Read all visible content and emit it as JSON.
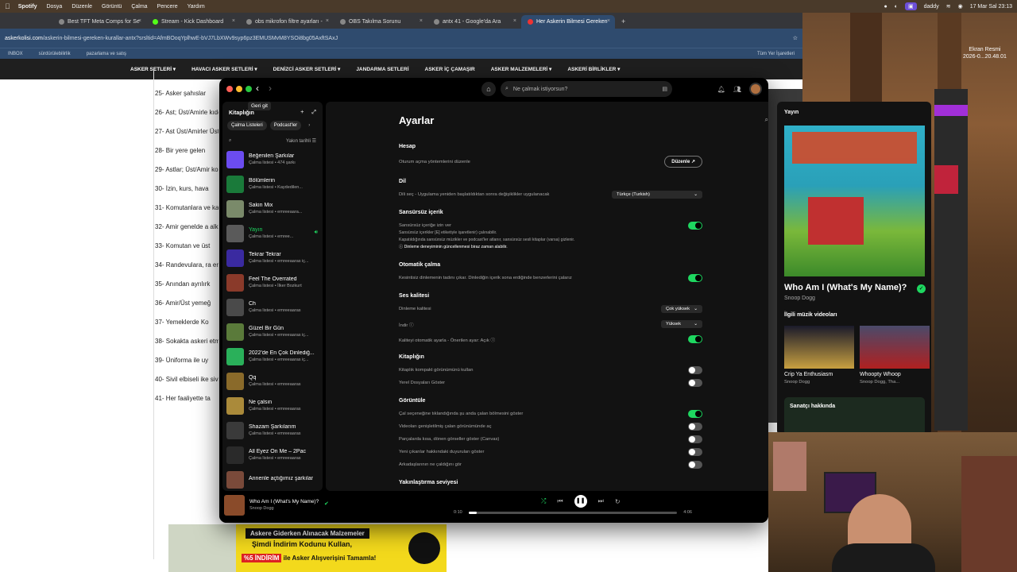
{
  "menubar": {
    "app": "Spotify",
    "items": [
      "Dosya",
      "Düzenle",
      "Görüntü",
      "Çalma",
      "Pencere",
      "Yardım"
    ],
    "user": "daddy",
    "clock": "17 Mar Sal  23:13"
  },
  "desktop": {
    "screenshot_label": "Ekran Resmi\n2026-0...20.48.01"
  },
  "chrome": {
    "tabs": [
      {
        "label": "Best TFT Meta Comps for Se"
      },
      {
        "label": "Stream - Kick Dashboard"
      },
      {
        "label": "obs mikrofon filtre ayarları -"
      },
      {
        "label": "OBS Takılma Sorunu"
      },
      {
        "label": "antx 41 - Google'da Ara"
      },
      {
        "label": "Her Askerin Bilmesi Gereken"
      }
    ],
    "url_host": "askerkolisi.com",
    "url_path": "/askerin-bilmesi-gereken-kurallar-antx?srsltid=AfmBOoqYplhwE-bVJ7LbXWv9syp6pz3EMUSMvM8YSOi8bg05AxftSAxJ",
    "bookmarks": [
      "INBOX",
      "sürdürülebilirlik",
      "pazarlama ve satış",
      "Tüm Yer İşaretleri"
    ],
    "sitenav": [
      "ASKER SETLERİ ▾",
      "HAVACI ASKER SETLERİ ▾",
      "DENİZCİ ASKER SETLERİ ▾",
      "JANDARMA SETLERİ",
      "ASKER İÇ ÇAMAŞIR",
      "ASKER MALZEMELERİ ▾",
      "ASKERİ BİRLİKLER ▾"
    ],
    "article_lines": [
      "tanıtılır.",
      "25- Asker şahıslar",
      "26- Ast; Üst/Amirle kıdemli biri varsa o",
      "27- Ast Üst/Amirler Üst/Amirin sağ ve s",
      "28- Bir yere gelen",
      "29- Astlar; Üst/Amir konuşur, bir seferde",
      "30- İzin, kurs, hava",
      "31- Komutanlara ve kaza gibi olaylar za",
      "32- Amir genelde a alkışı önce büyükle",
      "33- Komutan ve üst",
      "34- Randevulara, ra erken gitmekte uyg",
      "35- Anından ayrılırk",
      "36- Amir/Üst yemeğ",
      "37- Yemeklerde Ko",
      "38- Sokakta askeri etmez ve şakalaşm",
      "39- Üniforma ile uy",
      "40- Sivil elbiseli ike sivil elbiseye uydur",
      "41- Her faaliyette ta"
    ],
    "banner": {
      "heading": "Askere Giderken Alınacak Malzemeler",
      "line1": "Şimdi İndirim Kodunu Kullan,",
      "discount": "%5 İNDİRİM",
      "line2": " ile Asker Alışverişini Tamamla!"
    }
  },
  "spotify": {
    "back_tooltip": "Geri git",
    "search_placeholder": "Ne çalmak istiyorsun?",
    "library": {
      "title": "Kitaplığın",
      "chips": [
        "Çalma Listeleri",
        "Podcast'ler"
      ],
      "sort": "Yakın tarihli",
      "playlists": [
        {
          "name": "Beğenilen Şarkılar",
          "sub": "Çalma listesi • 474 şarkı",
          "color": "#6b4cf0",
          "playing": false
        },
        {
          "name": "Bölümlerin",
          "sub": "Çalma listesi • Kaydedilen...",
          "color": "#1a7a3a",
          "playing": false
        },
        {
          "name": "Sakin Mix",
          "sub": "Çalma listesi • emreeaara...",
          "color": "#7a8a6a",
          "playing": false
        },
        {
          "name": "Yayın",
          "sub": "Çalma listesi • emree...",
          "color": "#5a5a5a",
          "playing": true
        },
        {
          "name": "Tekrar Tekrar",
          "sub": "Çalma listesi • emreeaaras iç...",
          "color": "#3a2aa0",
          "playing": false
        },
        {
          "name": "Feel The Overrated",
          "sub": "Çalma listesi • İlker Bozkurt",
          "color": "#8a3a2a",
          "playing": false
        },
        {
          "name": "Ch",
          "sub": "Çalma listesi • emreeaaras",
          "color": "#4a4a4a",
          "playing": false
        },
        {
          "name": "Güzel Bir Gün",
          "sub": "Çalma listesi • emreeaaras iç...",
          "color": "#5a7a3a",
          "playing": false
        },
        {
          "name": "2022'de En Çok Dinlediğ...",
          "sub": "Çalma listesi • emreeaaras iç...",
          "color": "#2ab05a",
          "playing": false
        },
        {
          "name": "Qq",
          "sub": "Çalma listesi • emreeaaras",
          "color": "#8a6a2a",
          "playing": false
        },
        {
          "name": "Ne çalsın",
          "sub": "Çalma listesi • emreeaaras",
          "color": "#aa8a3a",
          "playing": false
        },
        {
          "name": "Shazam Şarkılarım",
          "sub": "Çalma listesi • emreeaaras",
          "color": "#3a3a3a",
          "playing": false
        },
        {
          "name": "All Eyez On Me – 2Pac",
          "sub": "Çalma listesi • emreeaaras",
          "color": "#2a2a2a",
          "playing": false
        },
        {
          "name": "Annenle açtığımız şarkılar",
          "sub": "",
          "color": "#7a4a3a",
          "playing": false
        }
      ]
    },
    "settings": {
      "title": "Ayarlar",
      "account": {
        "title": "Hesap",
        "desc": "Oturum açma yöntemlerini düzenle",
        "button": "Düzenle ↗"
      },
      "language": {
        "title": "Dil",
        "desc": "Dili seç - Uygulama yeniden başlatıldıktan sonra değişiklikler uygulanacak",
        "value": "Türkçe (Turkish)"
      },
      "explicit": {
        "title": "Sansürsüz içerik",
        "desc": "Sansürsüz içeriğe izin ver",
        "note1": "Sansürsüz içerikler [E] etiketiyle işaretlenir) çalınabilir.",
        "note2": "Kapatıldığında sansürsüz müzikler ve podcast'ler atlanır, sansürsüz sesli kitaplar (varsa) gizlenir.",
        "note3": "ⓘ Dinleme deneyiminin güncellenmesi biraz zaman alabilir."
      },
      "autoplay": {
        "title": "Otomatik çalma",
        "desc": "Kesintisiz dinlemenin tadını çıkar. Dinlediğin içerik sona erdiğinde benzerlerini çalarız"
      },
      "audio": {
        "title": "Ses kalitesi",
        "stream_label": "Dinleme kalitesi",
        "stream_value": "Çok yüksek",
        "download_label": "İndir ⓘ",
        "download_value": "Yüksek",
        "auto_label": "Kaliteyi otomatik ayarla - Önerilen ayar: Açık ⓘ"
      },
      "library": {
        "title": "Kitaplığın",
        "compact": "Kitaplık kompakt görünümünü kullan",
        "local": "Yerel Dosyaları Göster"
      },
      "display": {
        "title": "Görüntüle",
        "rows": [
          "Çal seçeneğine tıklandığında şu anda çalan bölmesini göster",
          "Videoları genişletilmiş çalan görünümünde aç",
          "Parçalarda kısa, dönen görseller göster (Canvas)",
          "Yeni çıkanlar hakkındaki duyuruları göster",
          "Arkadaşlarının ne çaldığını gör"
        ]
      },
      "zoom": {
        "title": "Yakınlaştırma seviyesi"
      }
    },
    "player": {
      "title": "Who Am I (What's My Name)?",
      "artist": "Snoop Dogg",
      "elapsed": "0:10",
      "duration": "4:06",
      "progress": 0.04
    },
    "now_playing_panel": {
      "heading": "Yayın",
      "track": "Who Am I (What's My Name)?",
      "artist": "Snoop Dogg",
      "videos_title": "İlgili müzik videoları",
      "videos": [
        {
          "title": "Crip Ya Enthusiasm",
          "artist": "Snoop Dogg"
        },
        {
          "title": "Whoopty Whoop",
          "artist": "Snoop Dogg, Tha..."
        }
      ],
      "about_artist": "Sanatçı hakkında"
    }
  },
  "toggles": {
    "explicit": true,
    "autoplay": true,
    "auto_quality": true,
    "compact": false,
    "local": false,
    "display": [
      true,
      false,
      false,
      false,
      false
    ]
  }
}
